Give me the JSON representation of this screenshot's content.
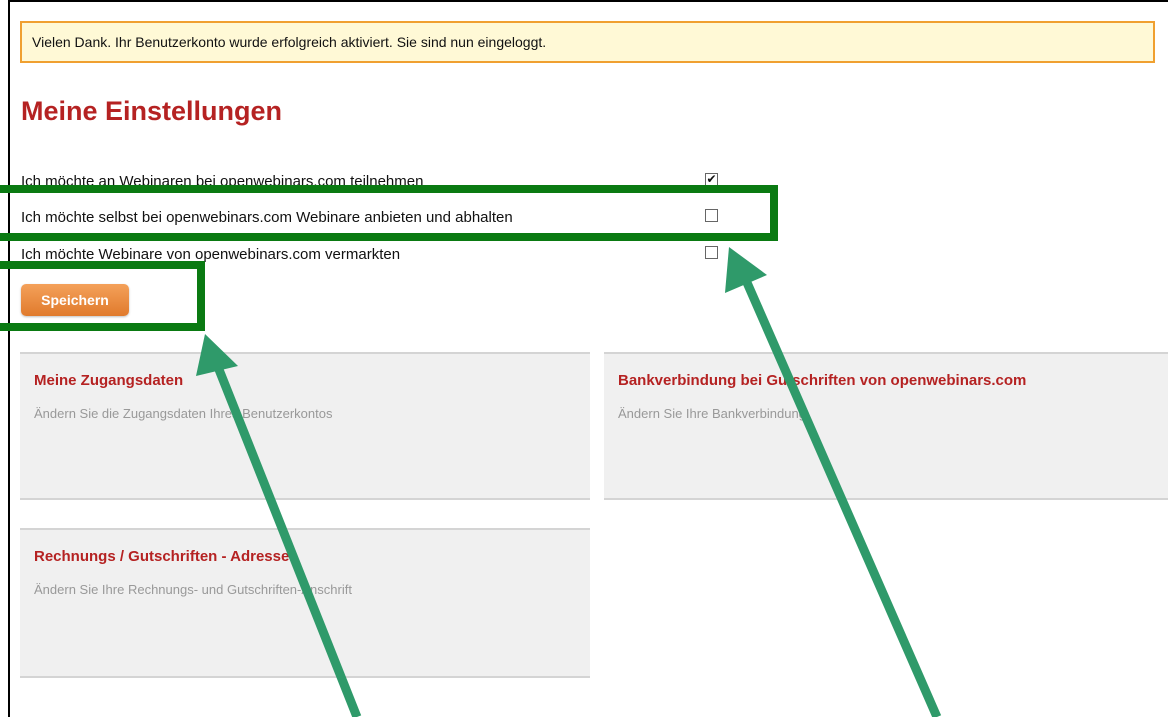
{
  "notice": {
    "text": "Vielen Dank. Ihr Benutzerkonto wurde erfolgreich aktiviert. Sie sind nun eingeloggt."
  },
  "page_title": "Meine Einstellungen",
  "options": [
    {
      "label": "Ich möchte an Webinaren bei openwebinars.com teilnehmen",
      "checked": true
    },
    {
      "label": "Ich möchte selbst bei openwebinars.com Webinare anbieten und abhalten",
      "checked": false
    },
    {
      "label": "Ich möchte Webinare von openwebinars.com vermarkten",
      "checked": false
    }
  ],
  "save_button": "Speichern",
  "cards": [
    {
      "title": "Meine Zugangsdaten",
      "desc": "Ändern Sie die Zugangsdaten Ihres Benutzerkontos"
    },
    {
      "title": "Bankverbindung bei Gutschriften von openwebinars.com",
      "desc": "Ändern Sie Ihre Bankverbindung"
    },
    {
      "title": "Rechnungs / Gutschriften - Adresse",
      "desc": "Ändern Sie Ihre Rechnungs- und Gutschriften-Anschrift"
    }
  ],
  "colors": {
    "title_red": "#b52222",
    "button_orange": "#e8843a",
    "annotation_box": "#0a7a12",
    "annotation_arrow": "#2f9a6a"
  },
  "checkbox_mark": "✔"
}
